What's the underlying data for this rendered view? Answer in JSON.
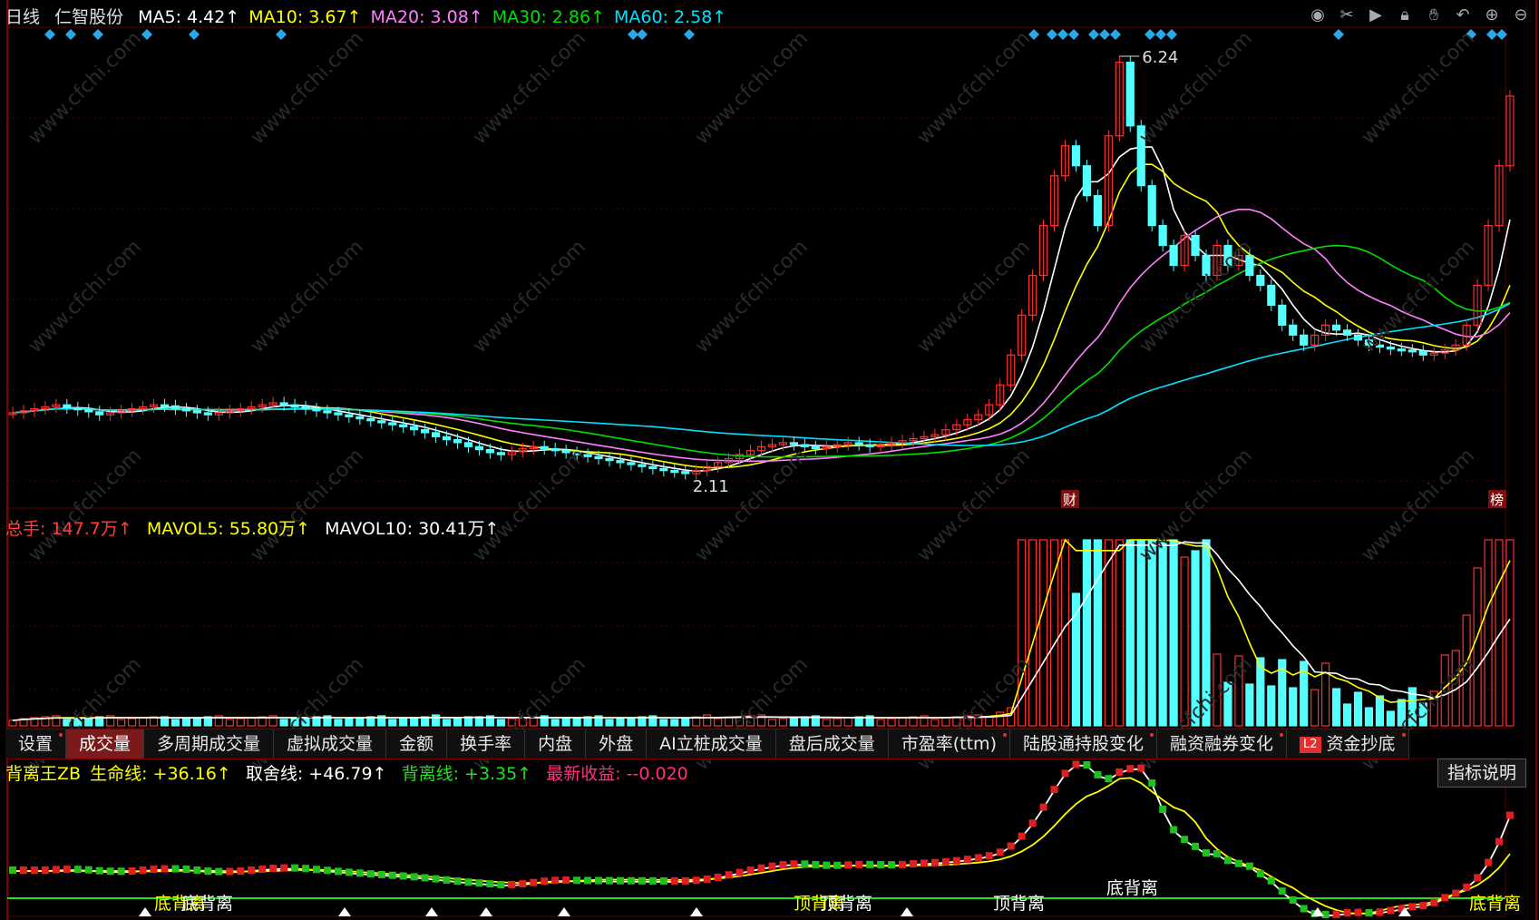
{
  "header": {
    "period": "日线",
    "stock": "仁智股份",
    "ma": [
      {
        "label": "MA5: 4.42↑",
        "color": "#ffffff"
      },
      {
        "label": "MA10: 3.67↑",
        "color": "#ffff00"
      },
      {
        "label": "MA20: 3.08↑",
        "color": "#ff80ff"
      },
      {
        "label": "MA30: 2.86↑",
        "color": "#00e000"
      },
      {
        "label": "MA60: 2.58↑",
        "color": "#00e0ff"
      }
    ]
  },
  "toolbar_icons": [
    "eye-icon",
    "scissors-icon",
    "play-icon",
    "lock-icon",
    "hand-icon",
    "undo-icon",
    "zoom-in-icon",
    "zoom-out-icon"
  ],
  "price_chart": {
    "high_label": "6.24",
    "low_label": "2.11",
    "badges": [
      "财",
      "榜"
    ],
    "ylim": [
      1.9,
      6.5
    ]
  },
  "volume_panel": {
    "total": "总手: 147.7万↑",
    "mavol5": "MAVOL5: 55.80万↑",
    "mavol10": "MAVOL10: 30.41万↑",
    "colors": {
      "total": "#ff4040",
      "mavol5": "#ffff00",
      "mavol10": "#ffffff"
    }
  },
  "tabs": [
    {
      "label": "设置",
      "dot": true
    },
    {
      "label": "成交量",
      "active": true
    },
    {
      "label": "多周期成交量"
    },
    {
      "label": "虚拟成交量"
    },
    {
      "label": "金额"
    },
    {
      "label": "换手率"
    },
    {
      "label": "内盘"
    },
    {
      "label": "外盘"
    },
    {
      "label": "AI立桩成交量"
    },
    {
      "label": "盘后成交量"
    },
    {
      "label": "市盈率(ttm)",
      "dot": true
    },
    {
      "label": "陆股通持股变化",
      "dot": true
    },
    {
      "label": "融资融券变化",
      "dot": true
    },
    {
      "label": "资金抄底",
      "dot": true,
      "badge": "L2"
    }
  ],
  "indicator": {
    "name": "背离王ZB",
    "life_line": "生命线: +36.16↑",
    "exit_line": "取舍线: +46.79↑",
    "div_line": "背离线: +3.35↑",
    "latest_return": "最新收益: --0.020",
    "explain_button": "指标说明",
    "labels": [
      "底背离",
      "底背离",
      "顶背离",
      "顶背离",
      "顶背离",
      "底背离",
      "底背离",
      "顶背离",
      "顶背离",
      "底背离"
    ]
  },
  "colors": {
    "up": "#ff3030",
    "down": "#54ffff",
    "grid": "#5a0000"
  },
  "chart_data": {
    "type": "candlestick",
    "closes": [
      2.72,
      2.74,
      2.76,
      2.78,
      2.8,
      2.77,
      2.75,
      2.73,
      2.7,
      2.72,
      2.74,
      2.76,
      2.78,
      2.8,
      2.79,
      2.76,
      2.74,
      2.72,
      2.7,
      2.72,
      2.74,
      2.76,
      2.78,
      2.8,
      2.82,
      2.8,
      2.78,
      2.76,
      2.74,
      2.72,
      2.7,
      2.68,
      2.66,
      2.64,
      2.62,
      2.6,
      2.58,
      2.55,
      2.52,
      2.48,
      2.45,
      2.42,
      2.38,
      2.35,
      2.32,
      2.3,
      2.33,
      2.36,
      2.38,
      2.36,
      2.34,
      2.32,
      2.3,
      2.28,
      2.26,
      2.24,
      2.22,
      2.2,
      2.18,
      2.16,
      2.14,
      2.13,
      2.11,
      2.14,
      2.18,
      2.22,
      2.26,
      2.3,
      2.34,
      2.38,
      2.4,
      2.42,
      2.4,
      2.38,
      2.36,
      2.38,
      2.4,
      2.42,
      2.4,
      2.38,
      2.4,
      2.42,
      2.44,
      2.46,
      2.48,
      2.5,
      2.55,
      2.6,
      2.65,
      2.7,
      2.8,
      3.0,
      3.3,
      3.7,
      4.1,
      4.6,
      5.1,
      5.4,
      5.2,
      4.9,
      4.6,
      5.5,
      6.24,
      5.6,
      5.0,
      4.6,
      4.4,
      4.2,
      4.5,
      4.3,
      4.1,
      4.4,
      4.2,
      4.3,
      4.1,
      4.0,
      3.8,
      3.6,
      3.5,
      3.4,
      3.5,
      3.6,
      3.55,
      3.5,
      3.45,
      3.4,
      3.38,
      3.36,
      3.35,
      3.34,
      3.3,
      3.32,
      3.35,
      3.4,
      3.6,
      4.0,
      4.6,
      5.2,
      5.9
    ],
    "ma5_last": 4.42,
    "ma10_last": 3.67,
    "ma20_last": 3.08,
    "ma30_last": 2.86,
    "ma60_last": 2.58
  }
}
